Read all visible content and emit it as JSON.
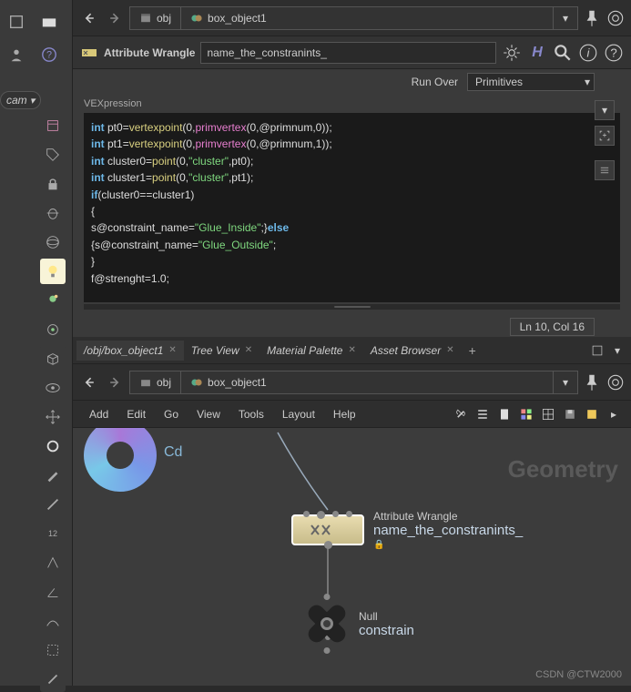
{
  "left_cam": "cam",
  "path": {
    "seg1": "obj",
    "seg2": "box_object1"
  },
  "node_header": {
    "type": "Attribute Wrangle",
    "name": "name_the_constranints_"
  },
  "run_over": {
    "label": "Run Over",
    "value": "Primitives"
  },
  "vex_label": "VEXpression",
  "code_tokens": [
    [
      [
        "kw",
        "int"
      ],
      [
        "op",
        " pt0="
      ],
      [
        "fn",
        "vertexpoint"
      ],
      [
        "op",
        "("
      ],
      [
        "num",
        "0"
      ],
      [
        "op",
        ","
      ],
      [
        "arg",
        "primvertex"
      ],
      [
        "op",
        "("
      ],
      [
        "num",
        "0"
      ],
      [
        "op",
        ",@primnum,"
      ],
      [
        "num",
        "0"
      ],
      [
        "op",
        "));"
      ]
    ],
    [
      [
        "kw",
        "int"
      ],
      [
        "op",
        " pt1="
      ],
      [
        "fn",
        "vertexpoint"
      ],
      [
        "op",
        "("
      ],
      [
        "num",
        "0"
      ],
      [
        "op",
        ","
      ],
      [
        "arg",
        "primvertex"
      ],
      [
        "op",
        "("
      ],
      [
        "num",
        "0"
      ],
      [
        "op",
        ",@primnum,"
      ],
      [
        "num",
        "1"
      ],
      [
        "op",
        "));"
      ]
    ],
    [
      [
        "kw",
        "int"
      ],
      [
        "op",
        " cluster0="
      ],
      [
        "fn",
        "point"
      ],
      [
        "op",
        "("
      ],
      [
        "num",
        "0"
      ],
      [
        "op",
        ","
      ],
      [
        "str",
        "\"cluster\""
      ],
      [
        "op",
        ",pt0);"
      ]
    ],
    [
      [
        "kw",
        "int"
      ],
      [
        "op",
        " cluster1="
      ],
      [
        "fn",
        "point"
      ],
      [
        "op",
        "("
      ],
      [
        "num",
        "0"
      ],
      [
        "op",
        ","
      ],
      [
        "str",
        "\"cluster\""
      ],
      [
        "op",
        ",pt1);"
      ]
    ],
    [
      [
        "kw",
        "if"
      ],
      [
        "op",
        "(cluster0==cluster1)"
      ]
    ],
    [
      [
        "op",
        "{"
      ]
    ],
    [
      [
        "op",
        "s@constraint_name="
      ],
      [
        "str",
        "\"Glue_Inside\""
      ],
      [
        "op",
        ";}"
      ],
      [
        "kw",
        "else"
      ]
    ],
    [
      [
        "op",
        "{s@constraint_name="
      ],
      [
        "str",
        "\"Glue_Outside\""
      ],
      [
        "op",
        ";"
      ]
    ],
    [
      [
        "op",
        "}"
      ]
    ],
    [
      [
        "op",
        "f@strenght="
      ],
      [
        "num",
        "1.0"
      ],
      [
        "op",
        ";"
      ]
    ]
  ],
  "status": "Ln 10, Col 16",
  "tabs": [
    {
      "label": "/obj/box_object1",
      "active": true
    },
    {
      "label": "Tree View"
    },
    {
      "label": "Material Palette"
    },
    {
      "label": "Asset Browser"
    }
  ],
  "menu": [
    "Add",
    "Edit",
    "Go",
    "View",
    "Tools",
    "Layout",
    "Help"
  ],
  "geo_label": "Geometry",
  "cd_label": "Cd",
  "nodes": {
    "wrangle": {
      "type": "Attribute Wrangle",
      "name": "name_the_constranints_"
    },
    "null": {
      "type": "Null",
      "name": "constrain"
    }
  },
  "watermark": "CSDN @CTW2000"
}
